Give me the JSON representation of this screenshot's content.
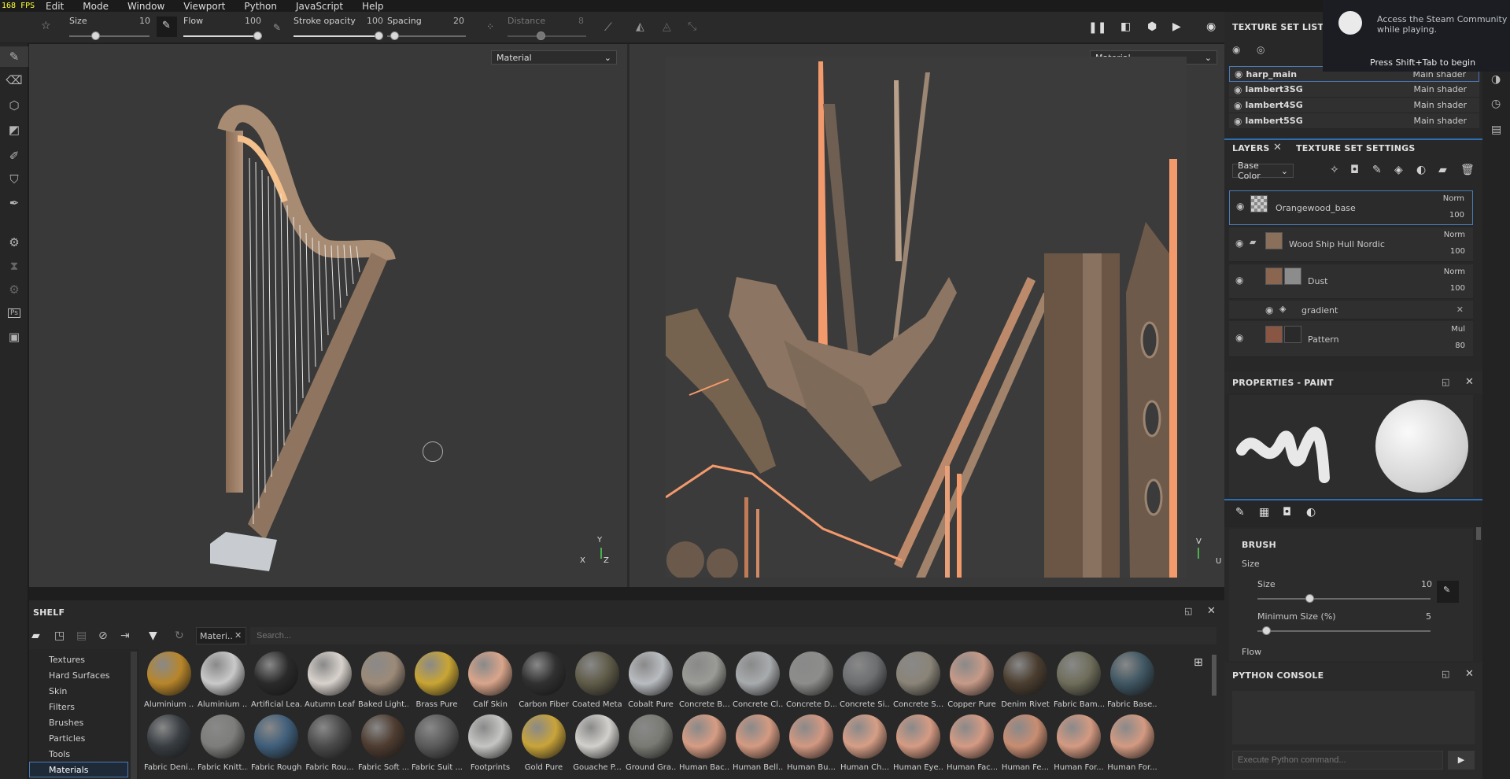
{
  "fps": "168 FPS",
  "menu": [
    "Edit",
    "Mode",
    "Window",
    "Viewport",
    "Python",
    "JavaScript",
    "Help"
  ],
  "toolbar": {
    "size_label": "Size",
    "size_value": "10",
    "flow_label": "Flow",
    "flow_value": "100",
    "stroke_opacity_label": "Stroke opacity",
    "stroke_opacity_value": "100",
    "spacing_label": "Spacing",
    "spacing_value": "20",
    "distance_label": "Distance",
    "distance_value": "8"
  },
  "viewport3d": {
    "mode": "Material",
    "axis_y": "Y",
    "axis_x": "X",
    "axis_z": "Z"
  },
  "viewport2d": {
    "mode": "Material",
    "axis_v": "V",
    "axis_u": "U"
  },
  "texture_set_list": {
    "title": "TEXTURE SET LIST",
    "rows": [
      {
        "name": "harp_main",
        "shader": "Main shader"
      },
      {
        "name": "lambert3SG",
        "shader": "Main shader"
      },
      {
        "name": "lambert4SG",
        "shader": "Main shader"
      },
      {
        "name": "lambert5SG",
        "shader": "Main shader"
      }
    ]
  },
  "steam": {
    "line1": "Access the Steam Community",
    "line2": "while playing.",
    "hint": "Press Shift+Tab to begin"
  },
  "layers": {
    "tab_layers": "LAYERS",
    "tab_settings": "TEXTURE SET SETTINGS",
    "channel": "Base Color",
    "items": [
      {
        "name": "Orangewood_base",
        "blend": "Norm",
        "opacity": "100"
      },
      {
        "name": "Wood Ship Hull Nordic",
        "blend": "Norm",
        "opacity": "100"
      },
      {
        "name": "Dust",
        "blend": "Norm",
        "opacity": "100"
      },
      {
        "name": "gradient"
      },
      {
        "name": "Pattern",
        "blend": "Mul",
        "opacity": "80"
      }
    ]
  },
  "properties": {
    "title": "PROPERTIES - PAINT",
    "brush_header": "BRUSH",
    "size_group": "Size",
    "size_label": "Size",
    "size_value": "10",
    "size_fraction": 0.3,
    "minsize_label": "Minimum Size (%)",
    "minsize_value": "5",
    "minsize_fraction": 0.05,
    "flow_label": "Flow"
  },
  "python_console": {
    "title": "PYTHON CONSOLE",
    "placeholder": "Execute Python command..."
  },
  "shelf": {
    "title": "SHELF",
    "filter_tag": "Materi..",
    "search_placeholder": "Search...",
    "categories": [
      "Textures",
      "Hard Surfaces",
      "Skin",
      "Filters",
      "Brushes",
      "Particles",
      "Tools",
      "Materials"
    ],
    "selected_category": "Materials",
    "row1": [
      {
        "label": "Aluminium ...",
        "color": "#b8862a"
      },
      {
        "label": "Aluminium ...",
        "color": "#c9c9c9"
      },
      {
        "label": "Artificial Lea...",
        "color": "#2a2a2a"
      },
      {
        "label": "Autumn Leaf",
        "color": "#d8d2cc"
      },
      {
        "label": "Baked Light...",
        "color": "#9c8a78"
      },
      {
        "label": "Brass Pure",
        "color": "#c9a534"
      },
      {
        "label": "Calf Skin",
        "color": "#d9a58b"
      },
      {
        "label": "Carbon Fiber",
        "color": "#303030"
      },
      {
        "label": "Coated Metal",
        "color": "#5f5b48"
      },
      {
        "label": "Cobalt Pure",
        "color": "#b9bcc0"
      },
      {
        "label": "Concrete B...",
        "color": "#9a9a96"
      },
      {
        "label": "Concrete Cl...",
        "color": "#a8abad"
      },
      {
        "label": "Concrete D...",
        "color": "#8d8d8b"
      },
      {
        "label": "Concrete Si...",
        "color": "#6c6e70"
      },
      {
        "label": "Concrete S...",
        "color": "#8a8478"
      },
      {
        "label": "Copper Pure",
        "color": "#c79a88"
      },
      {
        "label": "Denim Rivet",
        "color": "#4b3e30"
      },
      {
        "label": "Fabric Bam...",
        "color": "#6e6d5a"
      },
      {
        "label": "Fabric Base...",
        "color": "#3f5662"
      }
    ],
    "row2": [
      {
        "label": "Fabric Deni...",
        "color": "#383d42"
      },
      {
        "label": "Fabric Knitt...",
        "color": "#7d7d7b"
      },
      {
        "label": "Fabric Rough",
        "color": "#3f5e7a"
      },
      {
        "label": "Fabric Rou...",
        "color": "#4a4a4a"
      },
      {
        "label": "Fabric Soft ...",
        "color": "#4e3c30"
      },
      {
        "label": "Fabric Suit ...",
        "color": "#5a5a5a"
      },
      {
        "label": "Footprints",
        "color": "#c5c5c3"
      },
      {
        "label": "Gold Pure",
        "color": "#c9a43a"
      },
      {
        "label": "Gouache P...",
        "color": "#d2d0cc"
      },
      {
        "label": "Ground Gra...",
        "color": "#7a7a74"
      },
      {
        "label": "Human Bac...",
        "color": "#d69c84"
      },
      {
        "label": "Human Bell...",
        "color": "#d49a82"
      },
      {
        "label": "Human Bu...",
        "color": "#d29882"
      },
      {
        "label": "Human Ch...",
        "color": "#d69e86"
      },
      {
        "label": "Human Eye...",
        "color": "#d59b84"
      },
      {
        "label": "Human Fac...",
        "color": "#d49a84"
      },
      {
        "label": "Human Fe...",
        "color": "#c88d72"
      },
      {
        "label": "Human For...",
        "color": "#d49a82"
      },
      {
        "label": "Human For...",
        "color": "#d39a82"
      }
    ]
  }
}
